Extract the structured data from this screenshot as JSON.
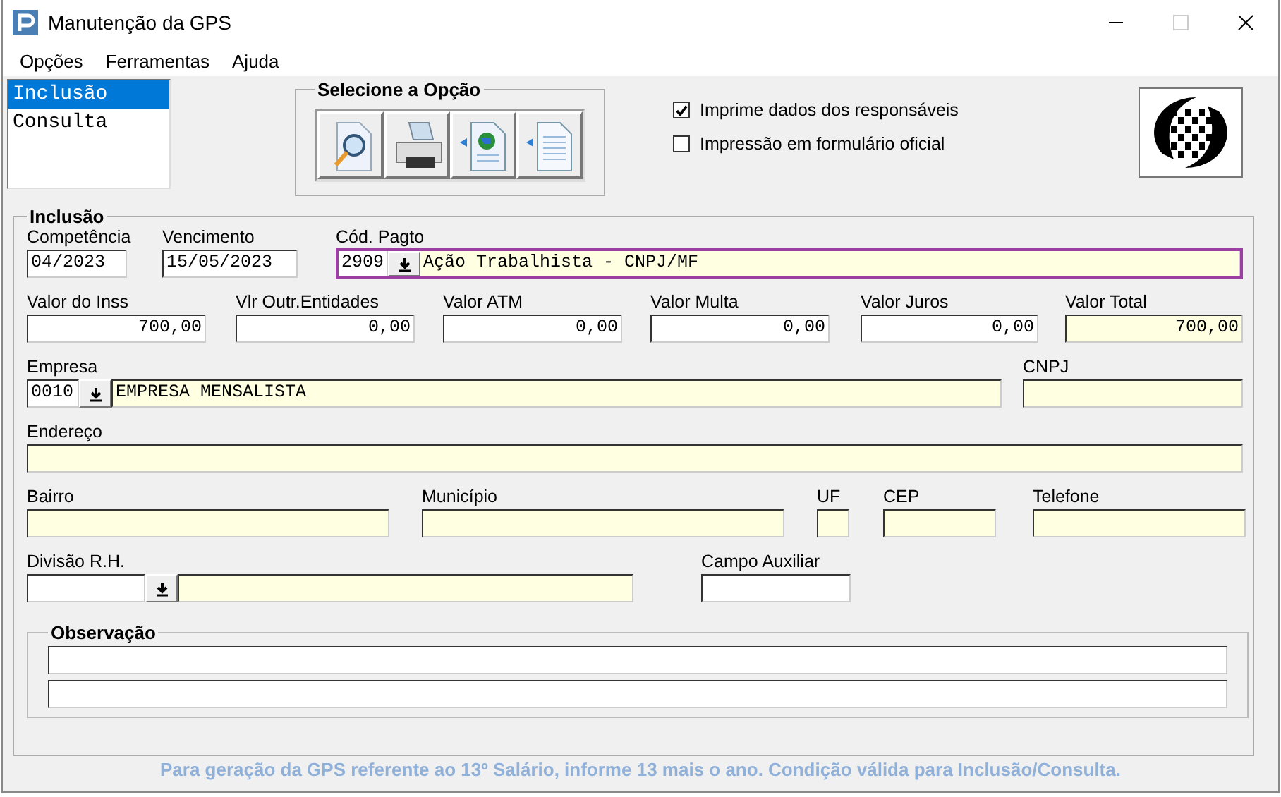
{
  "window": {
    "title": "Manutenção da GPS"
  },
  "menu": [
    {
      "label": "Opções"
    },
    {
      "label": "Ferramentas"
    },
    {
      "label": "Ajuda"
    }
  ],
  "mode_list": [
    {
      "label": "Inclusão",
      "selected": true
    },
    {
      "label": "Consulta",
      "selected": false
    }
  ],
  "option_group": {
    "title": "Selecione a Opção",
    "buttons": [
      {
        "kind": "preview"
      },
      {
        "kind": "print"
      },
      {
        "kind": "web"
      },
      {
        "kind": "document"
      }
    ]
  },
  "print_options": [
    {
      "label": "Imprime dados dos responsáveis",
      "checked": true
    },
    {
      "label": "Impressão em formulário oficial",
      "checked": false
    }
  ],
  "form": {
    "title": "Inclusão",
    "rows": [
      {
        "fields": [
          {
            "label": "Competência",
            "kind": "text",
            "value": "04/2023",
            "readonly": false,
            "focused": false
          },
          {
            "label": "Vencimento",
            "kind": "text",
            "value": "15/05/2023",
            "readonly": false,
            "focused": false
          },
          {
            "label": "Cód. Pagto",
            "kind": "lookup",
            "code": "2909",
            "value": "Ação Trabalhista - CNPJ/MF",
            "readonly": true,
            "focused": true
          }
        ]
      },
      {
        "fields": [
          {
            "label": "Valor do Inss",
            "kind": "number",
            "value": "700,00",
            "readonly": false,
            "focused": false
          },
          {
            "label": "Vlr Outr.Entidades",
            "kind": "number",
            "value": "0,00",
            "readonly": false,
            "focused": false
          },
          {
            "label": "Valor ATM",
            "kind": "number",
            "value": "0,00",
            "readonly": false,
            "focused": false
          },
          {
            "label": "Valor Multa",
            "kind": "number",
            "value": "0,00",
            "readonly": false,
            "focused": false
          },
          {
            "label": "Valor Juros",
            "kind": "number",
            "value": "0,00",
            "readonly": false,
            "focused": false
          },
          {
            "label": "Valor Total",
            "kind": "number",
            "value": "700,00",
            "readonly": true,
            "focused": false
          }
        ]
      },
      {
        "fields": [
          {
            "label": "Empresa",
            "kind": "lookup",
            "code": "0010",
            "value": "EMPRESA MENSALISTA",
            "readonly": true,
            "focused": false
          },
          {
            "label": "CNPJ",
            "kind": "text",
            "readonly": true,
            "focused": false
          }
        ]
      },
      {
        "fields": [
          {
            "label": "Endereço",
            "kind": "text",
            "readonly": true,
            "focused": false
          }
        ]
      },
      {
        "fields": [
          {
            "label": "Bairro",
            "kind": "text",
            "readonly": true,
            "focused": false
          },
          {
            "label": "Município",
            "kind": "text",
            "readonly": true,
            "focused": false
          },
          {
            "label": "UF",
            "kind": "text",
            "readonly": true,
            "focused": false
          },
          {
            "label": "CEP",
            "kind": "text",
            "readonly": true,
            "focused": false
          },
          {
            "label": "Telefone",
            "kind": "text",
            "readonly": true,
            "focused": false
          }
        ]
      },
      {
        "fields": [
          {
            "label": "Divisão R.H.",
            "kind": "lookup",
            "readonly": true,
            "focused": false
          },
          {
            "label": "Campo Auxiliar",
            "kind": "text",
            "readonly": false,
            "focused": false
          }
        ]
      }
    ]
  },
  "observation": {
    "title": "Observação",
    "lines": [
      {
        "kind": "text"
      },
      {
        "kind": "text"
      }
    ]
  },
  "footer": "Para geração da GPS referente ao 13º Salário, informe 13 mais o ano. Condição válida para Inclusão/Consulta."
}
